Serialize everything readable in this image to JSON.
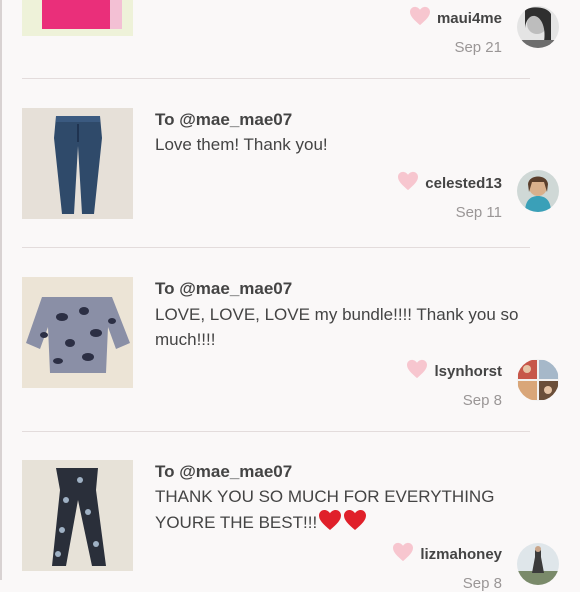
{
  "feed": [
    {
      "to": "",
      "message": "",
      "username": "maui4me",
      "date": "Sep 21",
      "thumb_icon": "pink-top-thumbnail",
      "avatar_icon": "grayscale-portrait-avatar"
    },
    {
      "to": "To @mae_mae07",
      "message": "Love them! Thank you!",
      "username": "celested13",
      "date": "Sep 11",
      "thumb_icon": "blue-jeans-thumbnail",
      "avatar_icon": "scarf-portrait-avatar"
    },
    {
      "to": "To @mae_mae07",
      "message": "LOVE, LOVE, LOVE my bundle!!!! Thank you so much!!!!",
      "username": "lsynhorst",
      "date": "Sep 8",
      "thumb_icon": "leopard-top-thumbnail",
      "avatar_icon": "photo-collage-avatar"
    },
    {
      "to": "To @mae_mae07",
      "message": "THANK YOU SO MUCH FOR EVERYTHING YOURE THE BEST!!!",
      "username": "lizmahoney",
      "date": "Sep 8",
      "thumb_icon": "print-pants-thumbnail",
      "avatar_icon": "outdoor-portrait-avatar"
    }
  ],
  "colors": {
    "heart": "#f7c6cf",
    "emoji_heart": "#e0202a",
    "divider": "#e3dcdc",
    "background": "#faf8f8"
  }
}
